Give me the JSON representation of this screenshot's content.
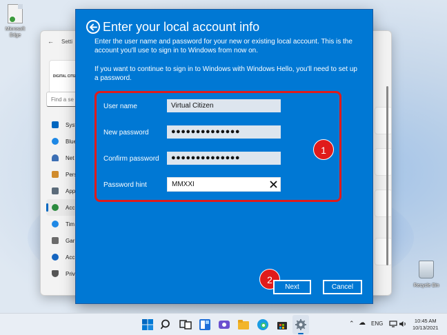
{
  "desktop": {
    "icons": [
      {
        "label": "Microsoft Edge",
        "icon": "edge-shortcut-icon"
      },
      {
        "label": "Recycle Bin",
        "icon": "recycle-bin-icon"
      }
    ]
  },
  "settings": {
    "title": "Setti",
    "profile_text": "DIGITAL CITIZEN",
    "search_placeholder": "Find a se",
    "nav_items": [
      {
        "label": "Syst",
        "icon": "monitor-icon",
        "color": "#0067c0"
      },
      {
        "label": "Blue",
        "icon": "bluetooth-icon",
        "color": "#1e88e5"
      },
      {
        "label": "Net",
        "icon": "wifi-icon",
        "color": "#3c6fb4"
      },
      {
        "label": "Pers",
        "icon": "brush-icon",
        "color": "#d08b2c"
      },
      {
        "label": "App",
        "icon": "apps-icon",
        "color": "#5b6b7a"
      },
      {
        "label": "Acc",
        "icon": "person-icon",
        "color": "#2b8a3e"
      },
      {
        "label": "Tim",
        "icon": "globe-icon",
        "color": "#1e88e5"
      },
      {
        "label": "Gar",
        "icon": "gamepad-icon",
        "color": "#6b6b6b"
      },
      {
        "label": "Acc",
        "icon": "accessibility-icon",
        "color": "#1565c0"
      },
      {
        "label": "Priv",
        "icon": "shield-icon",
        "color": "#555555"
      }
    ]
  },
  "dialog": {
    "title": "Enter your local account info",
    "description": "Enter the user name and password for your new or existing local account. This is the account you'll use to sign in to Windows from now on.",
    "hello_note": "If you want to continue to sign in to Windows with Windows Hello, you'll need to set up a password.",
    "fields": {
      "username": {
        "label": "User name",
        "value": "Virtual Citizen"
      },
      "new_password": {
        "label": "New password",
        "value": "●●●●●●●●●●●●●●"
      },
      "confirm_password": {
        "label": "Confirm password",
        "value": "●●●●●●●●●●●●●●"
      },
      "hint": {
        "label": "Password hint",
        "value": "MMXXI"
      }
    },
    "buttons": {
      "next": "Next",
      "cancel": "Cancel"
    },
    "annotations": {
      "one": "1",
      "two": "2"
    }
  },
  "taskbar": {
    "language": "ENG",
    "time": "10:45 AM",
    "date": "10/13/2021",
    "accent": "#0067c0"
  }
}
